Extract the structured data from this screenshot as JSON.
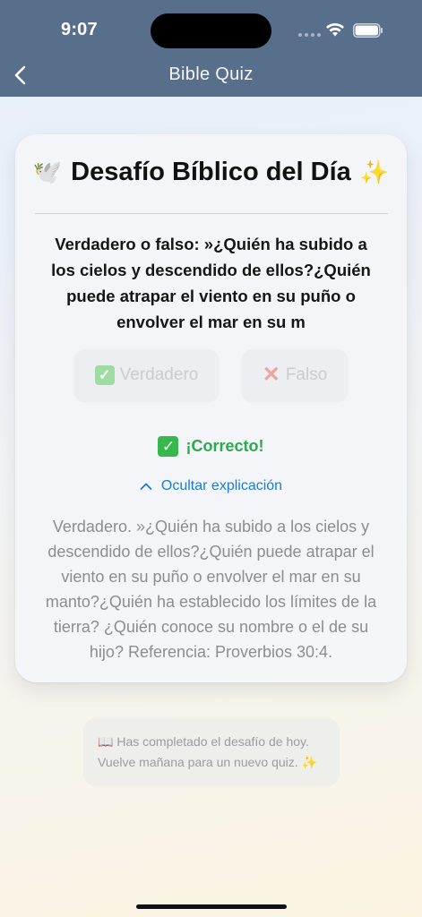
{
  "status_bar": {
    "time": "9:07"
  },
  "nav": {
    "title": "Bible Quiz",
    "back_icon": "chevron-left-icon"
  },
  "card": {
    "title": "Desafío Bíblico del Día",
    "title_leading_emoji": "🕊️",
    "title_trailing_emoji": "✨",
    "question": "Verdadero o falso: »¿Quién ha subido a los cielos y descendido de ellos?¿Quién puede atrapar el viento en su puño o envolver el mar en su m",
    "answers": [
      {
        "label": "Verdadero",
        "icon": "check-icon"
      },
      {
        "label": "Falso",
        "icon": "cross-icon"
      }
    ],
    "result": "¡Correcto!",
    "toggle_label": "Ocultar explicación",
    "explanation": "Verdadero. »¿Quién ha subido a los cielos y descendido de ellos?¿Quién puede atrapar el viento en su puño o envolver el mar en su manto?¿Quién ha establecido los límites de la tierra? ¿Quién conoce su nombre o el de su hijo? Referencia: Proverbios 30:4."
  },
  "completion_note": {
    "emoji": "📖",
    "line1": "Has completado el desafío de hoy.",
    "line2": "Vuelve mañana para un nuevo quiz.",
    "trailing_emoji": "✨"
  },
  "colors": {
    "nav_background": "#586f8c",
    "success": "#2fa84f",
    "link": "#1a7bd8"
  }
}
